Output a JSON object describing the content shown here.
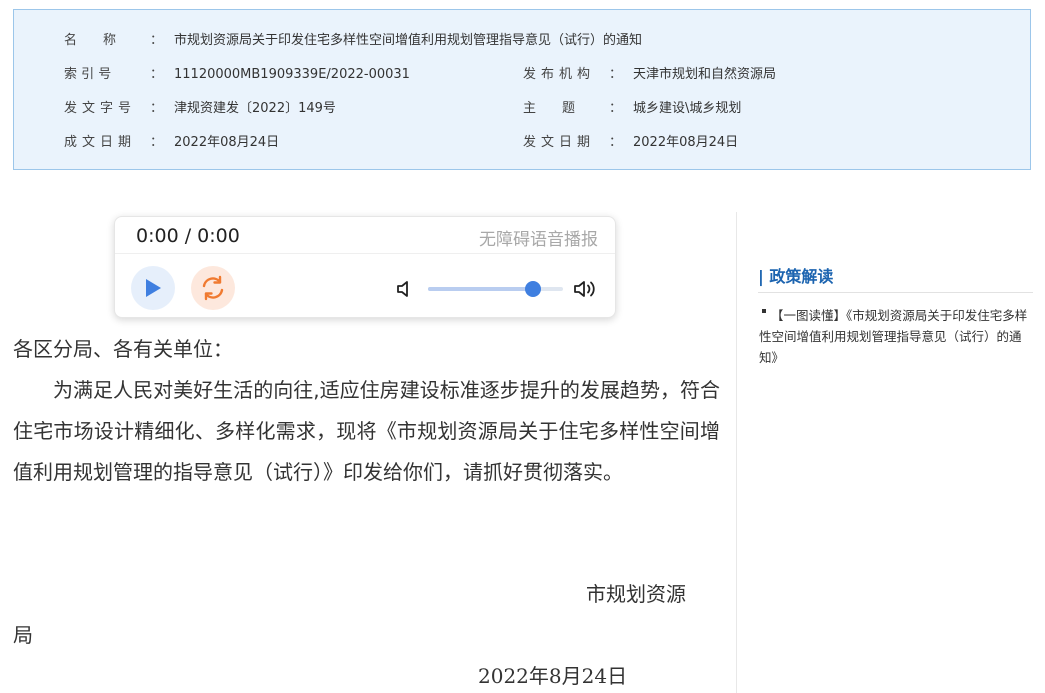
{
  "metadata": {
    "name_label": "名　　称",
    "name_value": "市规划资源局关于印发住宅多样性空间增值利用规划管理指导意见（试行）的通知",
    "index_label": "索 引 号",
    "index_value": "11120000MB1909339E/2022-00031",
    "publisher_label": "发布机构",
    "publisher_value": "天津市规划和自然资源局",
    "doc_no_label": "发文字号",
    "doc_no_value": "津规资建发〔2022〕149号",
    "subject_label": "主　　题",
    "subject_value": "城乡建设\\城乡规划",
    "created_label": "成文日期",
    "created_value": "2022年08月24日",
    "issued_label": "发文日期",
    "issued_value": "2022年08月24日",
    "colon": "："
  },
  "player": {
    "time": "0:00 / 0:00",
    "label": "无障碍语音播报",
    "volume": 0.78,
    "colors": {
      "play": "#3f7fe0",
      "replay": "#f07a30",
      "slider": "#3f7fe0"
    }
  },
  "article": {
    "salutation": "各区分局、各有关单位：",
    "body": "为满足人民对美好生活的向往,适应住房建设标准逐步提升的发展趋势，符合住宅市场设计精细化、多样化需求，现将《市规划资源局关于住宅多样性空间增值利用规划管理的指导意见（试行）》印发给你们，请抓好贯彻落实。",
    "signature_line1": "市规划资源",
    "signature_line2": "局",
    "date": "2022年8月24日"
  },
  "sidebar": {
    "title": "| 政策解读",
    "link_text": "【一图读懂】《市规划资源局关于印发住宅多样性空间增值利用规划管理指导意见（试行）的通知》"
  }
}
